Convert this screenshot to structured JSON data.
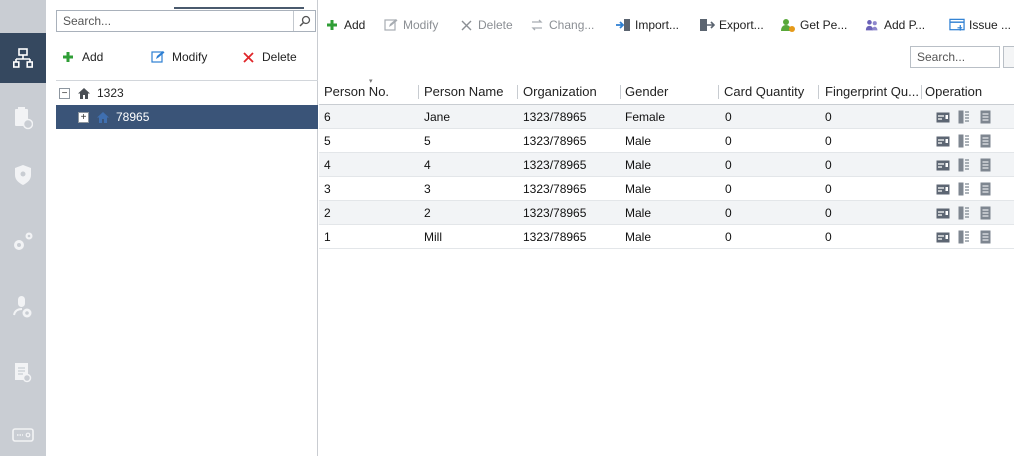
{
  "rail": {
    "items": [
      {
        "name": "person-organization-icon",
        "active": true
      },
      {
        "name": "schedule-clipboard-icon",
        "active": false
      },
      {
        "name": "shield-permission-icon",
        "active": false
      },
      {
        "name": "advanced-settings-gears-icon",
        "active": false
      },
      {
        "name": "device-user-icon",
        "active": false
      },
      {
        "name": "search-report-icon",
        "active": false
      },
      {
        "name": "device-status-icon",
        "active": false
      }
    ]
  },
  "tree": {
    "search_placeholder": "Search...",
    "toolbar": {
      "add_label": "Add",
      "modify_label": "Modify",
      "delete_label": "Delete"
    },
    "nodes": [
      {
        "label": "1323",
        "expander": "−",
        "selected": false
      },
      {
        "label": "78965",
        "expander": "+",
        "selected": true
      }
    ]
  },
  "toolbar": {
    "add_label": "Add",
    "modify_label": "Modify",
    "delete_label": "Delete",
    "change_label": "Chang...",
    "import_label": "Import...",
    "export_label": "Export...",
    "get_person_label": "Get Pe...",
    "add_person_label": "Add P...",
    "issue_label": "Issue ..."
  },
  "search": {
    "placeholder": "Search..."
  },
  "table": {
    "columns": [
      "Person No.",
      "Person Name",
      "Organization",
      "Gender",
      "Card Quantity",
      "Fingerprint Qu...",
      "Operation"
    ],
    "rows": [
      {
        "no": "6",
        "name": "Jane",
        "org": "1323/78965",
        "gender": "Female",
        "cards": "0",
        "fingerprints": "0"
      },
      {
        "no": "5",
        "name": "5",
        "org": "1323/78965",
        "gender": "Male",
        "cards": "0",
        "fingerprints": "0"
      },
      {
        "no": "4",
        "name": "4",
        "org": "1323/78965",
        "gender": "Male",
        "cards": "0",
        "fingerprints": "0"
      },
      {
        "no": "3",
        "name": "3",
        "org": "1323/78965",
        "gender": "Male",
        "cards": "0",
        "fingerprints": "0"
      },
      {
        "no": "2",
        "name": "2",
        "org": "1323/78965",
        "gender": "Male",
        "cards": "0",
        "fingerprints": "0"
      },
      {
        "no": "1",
        "name": "Mill",
        "org": "1323/78965",
        "gender": "Male",
        "cards": "0",
        "fingerprints": "0"
      }
    ]
  },
  "colors": {
    "rail_bg": "#c9cdd3",
    "rail_active": "#35485f",
    "selected_row": "#3a5478",
    "add_green": "#2f9e36",
    "delete_red": "#e0262a",
    "edit_blue": "#2d7fd3"
  }
}
